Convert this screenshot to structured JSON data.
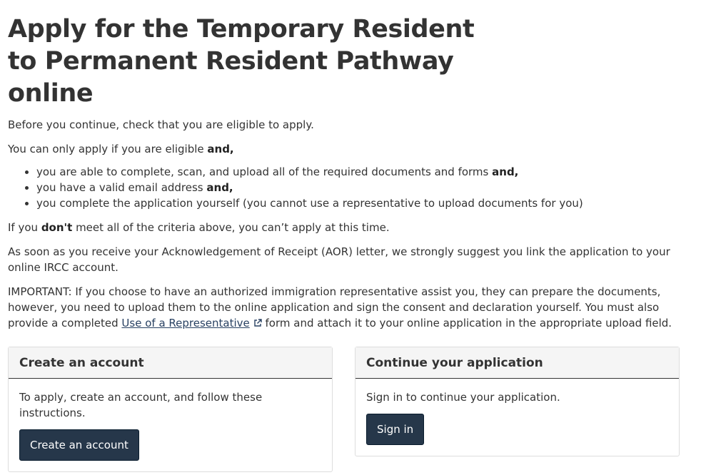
{
  "title": "Apply for the Temporary Resident to Permanent Resident Pathway online",
  "intro": "Before you continue, check that you are eligible to apply.",
  "eligible_prefix": "You can only apply if you are eligible ",
  "eligible_and": "and,",
  "criteria": [
    {
      "text": "you are able to complete, scan, and upload all of the required documents and forms ",
      "bold": "and,"
    },
    {
      "text": "you have a valid email address ",
      "bold": "and,"
    },
    {
      "text": "you complete the application yourself (you cannot use a representative to upload documents for you)",
      "bold": ""
    }
  ],
  "dont_prefix": "If you ",
  "dont_bold": "don't",
  "dont_suffix": " meet all of the criteria above, you can’t apply at this time.",
  "aor_text": "As soon as you receive your Acknowledgement of Receipt (AOR) letter, we strongly suggest you link the application to your online IRCC account.",
  "important_prefix": "IMPORTANT: If you choose to have an authorized immigration representative assist you, they can prepare the documents, however, you need to upload them to the online application and sign the consent and declaration yourself. You must also provide a completed ",
  "important_link": "Use of a Representative",
  "important_suffix": " form and attach it to your online application in the appropriate upload field.",
  "create_card": {
    "heading": "Create an account",
    "body": "To apply, create an account, and follow these instructions.",
    "button": "Create an account"
  },
  "continue_card": {
    "heading": "Continue your application",
    "body": "Sign in to continue your application.",
    "button": "Sign in"
  },
  "colors": {
    "button_bg": "#26374a",
    "link": "#284162",
    "text": "#333333",
    "card_header_bg": "#f5f5f5"
  },
  "icons": {
    "external_link": "external-link-icon"
  }
}
